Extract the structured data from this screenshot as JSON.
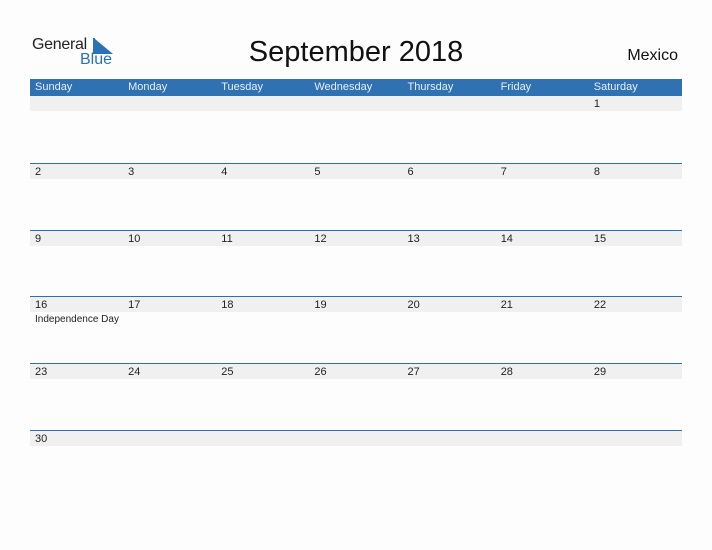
{
  "logo": {
    "general": "General",
    "blue": "Blue"
  },
  "title": "September 2018",
  "country": "Mexico",
  "colors": {
    "accent": "#2f71b1",
    "strip": "#f0f0f0"
  },
  "weekdays": [
    "Sunday",
    "Monday",
    "Tuesday",
    "Wednesday",
    "Thursday",
    "Friday",
    "Saturday"
  ],
  "weeks": [
    [
      {
        "d": ""
      },
      {
        "d": ""
      },
      {
        "d": ""
      },
      {
        "d": ""
      },
      {
        "d": ""
      },
      {
        "d": ""
      },
      {
        "d": "1"
      }
    ],
    [
      {
        "d": "2"
      },
      {
        "d": "3"
      },
      {
        "d": "4"
      },
      {
        "d": "5"
      },
      {
        "d": "6"
      },
      {
        "d": "7"
      },
      {
        "d": "8"
      }
    ],
    [
      {
        "d": "9"
      },
      {
        "d": "10"
      },
      {
        "d": "11"
      },
      {
        "d": "12"
      },
      {
        "d": "13"
      },
      {
        "d": "14"
      },
      {
        "d": "15"
      }
    ],
    [
      {
        "d": "16",
        "h": "Independence Day"
      },
      {
        "d": "17"
      },
      {
        "d": "18"
      },
      {
        "d": "19"
      },
      {
        "d": "20"
      },
      {
        "d": "21"
      },
      {
        "d": "22"
      }
    ],
    [
      {
        "d": "23"
      },
      {
        "d": "24"
      },
      {
        "d": "25"
      },
      {
        "d": "26"
      },
      {
        "d": "27"
      },
      {
        "d": "28"
      },
      {
        "d": "29"
      }
    ],
    [
      {
        "d": "30"
      },
      {
        "d": ""
      },
      {
        "d": ""
      },
      {
        "d": ""
      },
      {
        "d": ""
      },
      {
        "d": ""
      },
      {
        "d": ""
      }
    ]
  ]
}
